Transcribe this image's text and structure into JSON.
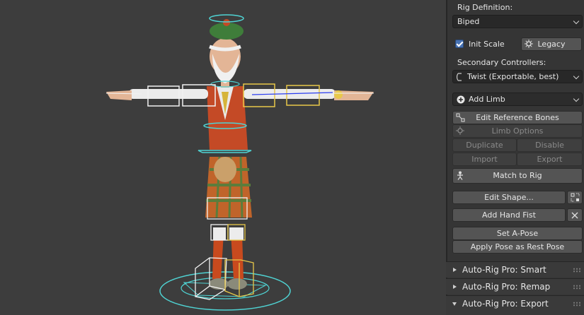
{
  "panel": {
    "rig_definition_label": "Rig Definition:",
    "rig_definition_value": "Biped",
    "init_scale_label": "Init Scale",
    "init_scale_checked": true,
    "legacy_label": "Legacy",
    "secondary_controllers_label": "Secondary Controllers:",
    "secondary_controllers_value": "Twist (Exportable, best)",
    "add_limb_label": "Add Limb",
    "edit_reference_bones_label": "Edit Reference Bones",
    "limb_options_label": "Limb Options",
    "duplicate_label": "Duplicate",
    "disable_label": "Disable",
    "import_label": "Import",
    "export_label": "Export",
    "match_to_rig_label": "Match to Rig",
    "edit_shape_label": "Edit Shape...",
    "add_hand_fist_label": "Add Hand Fist",
    "set_a_pose_label": "Set A-Pose",
    "apply_pose_label": "Apply Pose as Rest Pose"
  },
  "subpanels": [
    {
      "title": "Auto-Rig Pro: Smart",
      "expanded": false
    },
    {
      "title": "Auto-Rig Pro: Remap",
      "expanded": false
    },
    {
      "title": "Auto-Rig Pro: Export",
      "expanded": true
    }
  ],
  "colors": {
    "viewport_bg": "#3d3d3d",
    "panel_bg": "#353535",
    "accent_blue": "#4772b3",
    "control_cyan": "#4fd3d3",
    "control_yellow": "#e8c84a",
    "control_white": "#f2f2f2"
  }
}
